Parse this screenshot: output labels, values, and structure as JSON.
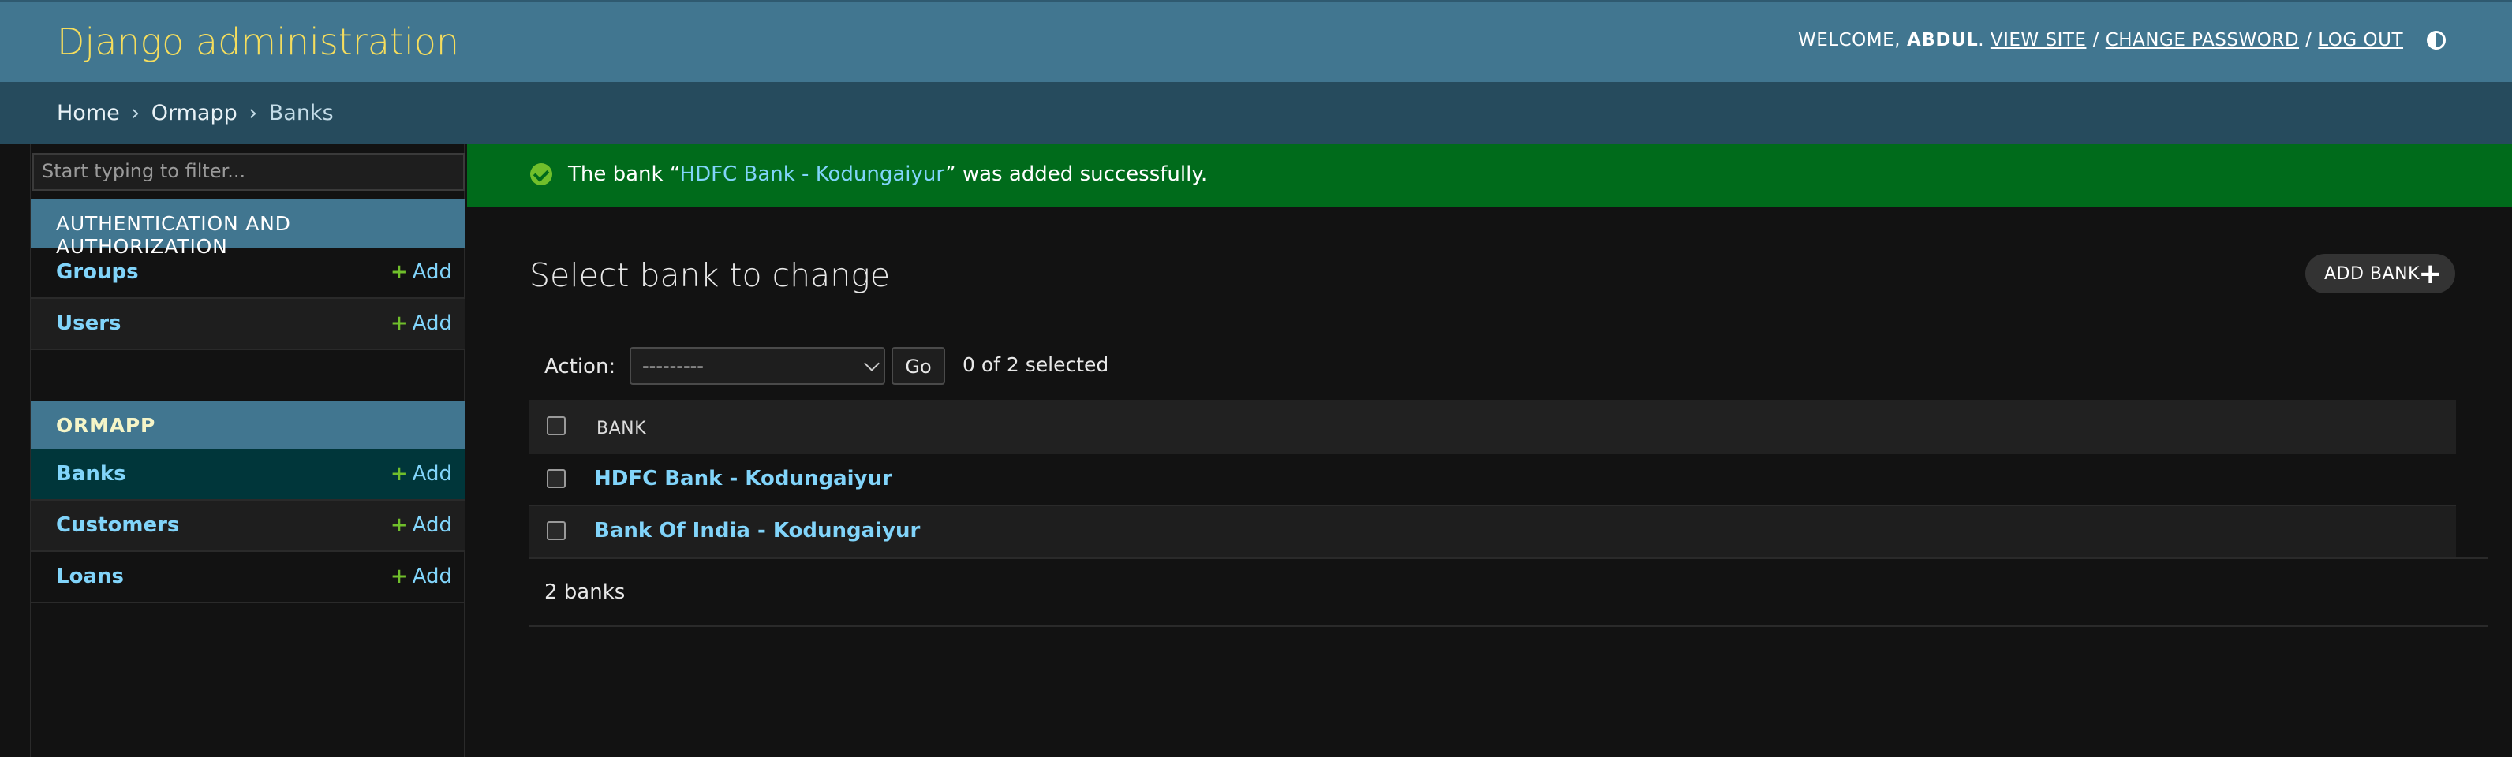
{
  "header": {
    "site_name": "Django administration",
    "welcome": "WELCOME,",
    "username": "ABDUL",
    "view_site": "VIEW SITE",
    "change_password": "CHANGE PASSWORD",
    "log_out": "LOG OUT",
    "separator": "/",
    "theme_icon": "theme-toggle-icon"
  },
  "breadcrumbs": {
    "home": "Home",
    "app": "Ormapp",
    "model": "Banks",
    "arrow": "›"
  },
  "sidebar": {
    "filter_placeholder": "Start typing to filter...",
    "modules": [
      {
        "caption": "AUTHENTICATION AND AUTHORIZATION",
        "models": [
          {
            "name": "Groups",
            "add": "Add"
          },
          {
            "name": "Users",
            "add": "Add"
          }
        ]
      },
      {
        "caption": "ORMAPP",
        "models": [
          {
            "name": "Banks",
            "add": "Add"
          },
          {
            "name": "Customers",
            "add": "Add"
          },
          {
            "name": "Loans",
            "add": "Add"
          }
        ]
      }
    ]
  },
  "message": {
    "prefix": "The bank “",
    "link": "HDFC Bank - Kodungaiyur",
    "suffix": "” was added successfully."
  },
  "content": {
    "title": "Select bank to change",
    "add_button": "ADD BANK"
  },
  "actions": {
    "label": "Action:",
    "selected_value": "---------",
    "go": "Go",
    "counter": "0 of 2 selected"
  },
  "table": {
    "column": "BANK",
    "rows": [
      {
        "name": "HDFC Bank - Kodungaiyur"
      },
      {
        "name": "Bank Of India - Kodungaiyur"
      }
    ]
  },
  "paginator": "2 banks",
  "colors": {
    "header_bg": "#417690",
    "breadcrumb_bg": "#264b5d",
    "site_name": "#f5dd5d",
    "link": "#81d4fa",
    "success_bg": "#006b1b",
    "add_plus": "#70bf2b",
    "selected_row_bg": "#00363a"
  }
}
